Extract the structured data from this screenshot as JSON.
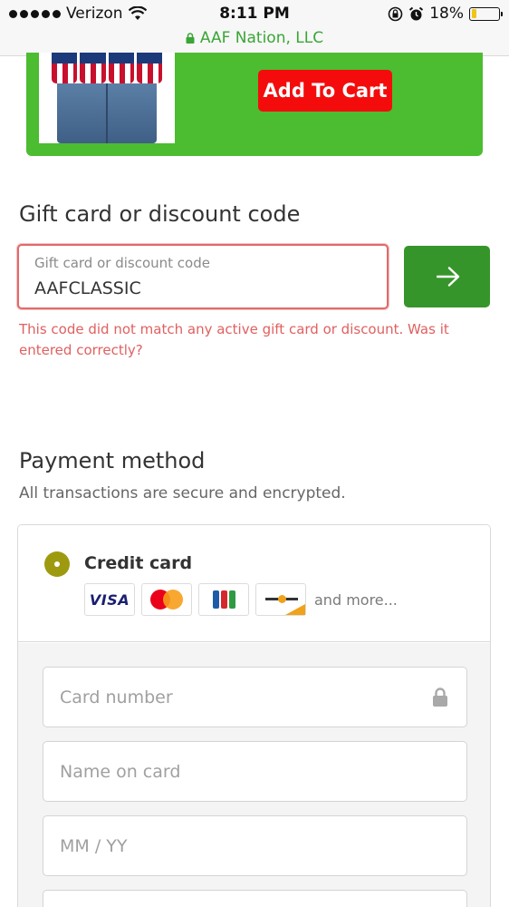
{
  "status_bar": {
    "carrier": "Verizon",
    "time": "8:11 PM",
    "battery_percent": "18%",
    "battery_level": 0.18,
    "battery_color": "#f0c419",
    "site": "AAF Nation, LLC"
  },
  "banner": {
    "background_color": "#4cbc31",
    "add_to_cart_label": "Add To Cart",
    "add_to_cart_color": "#f40c0c"
  },
  "gift_card": {
    "heading": "Gift card or discount code",
    "field_label": "Gift card or discount code",
    "field_value": "AAFCLASSIC",
    "apply_icon": "arrow-right-icon",
    "error_message": "This code did not match any active gift card or discount. Was it entered correctly?",
    "error_color": "#e06060"
  },
  "payment": {
    "heading": "Payment method",
    "subheading": "All transactions are secure and encrypted.",
    "option_label": "Credit card",
    "option_selected": true,
    "card_brands": [
      {
        "name": "visa",
        "label": "VISA"
      },
      {
        "name": "mastercard",
        "label": ""
      },
      {
        "name": "jcb",
        "label": ""
      },
      {
        "name": "generic-card",
        "label": ""
      }
    ],
    "more_label": "and more...",
    "fields": {
      "card_number_placeholder": "Card number",
      "name_on_card_placeholder": "Name on card",
      "expiry_placeholder": "MM / YY"
    }
  }
}
